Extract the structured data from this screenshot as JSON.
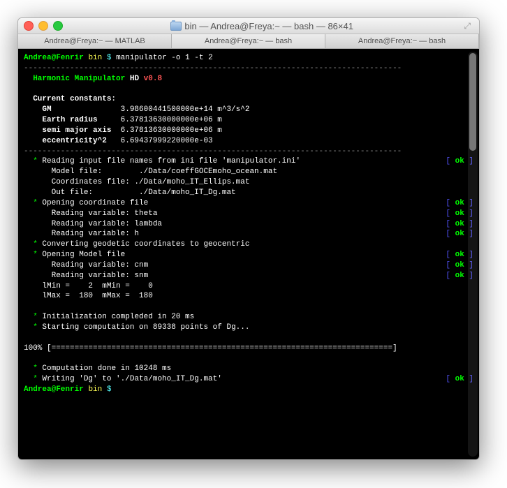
{
  "window": {
    "title": "bin — Andrea@Freya:~ — bash — 86×41"
  },
  "tabs": [
    {
      "label": "Andrea@Freya:~ — MATLAB"
    },
    {
      "label": "Andrea@Freya:~ — bash"
    },
    {
      "label": "Andrea@Freya:~ — bash"
    }
  ],
  "prompt": {
    "userhost": "Andrea@Fenrir",
    "dir": "bin",
    "sym": "$",
    "cmd": "manipulator -o 1 -t 2"
  },
  "rule": "----------------------------------------------------------------------------------",
  "header": {
    "prefix": "  Harmonic Manipulator",
    "hd": "HD",
    "ver": "v0.8"
  },
  "constants": {
    "heading": "  Current constants:",
    "rows": [
      {
        "k": "    GM             ",
        "v": "  3.98600441500000e+14 m^3/s^2"
      },
      {
        "k": "    Earth radius   ",
        "v": "  6.37813630000000e+06 m"
      },
      {
        "k": "    semi major axis",
        "v": "  6.37813630000000e+06 m"
      },
      {
        "k": "    eccentricity^2 ",
        "v": "  6.69437999220000e-03"
      }
    ]
  },
  "steps": [
    {
      "star": true,
      "text": "Reading input file names from ini file 'manipulator.ini'",
      "status": "ok"
    },
    {
      "star": false,
      "text": "  Model file:        ./Data/coeffGOCEmoho_ocean.mat"
    },
    {
      "star": false,
      "text": "  Coordinates file: ./Data/moho_IT_Ellips.mat"
    },
    {
      "star": false,
      "text": "  Out file:          ./Data/moho_IT_Dg.mat"
    },
    {
      "star": true,
      "text": "Opening coordinate file",
      "status": "ok"
    },
    {
      "star": false,
      "text": "  Reading variable: theta",
      "status": "ok"
    },
    {
      "star": false,
      "text": "  Reading variable: lambda",
      "status": "ok"
    },
    {
      "star": false,
      "text": "  Reading variable: h",
      "status": "ok"
    },
    {
      "star": true,
      "text": "Converting geodetic coordinates to geocentric"
    },
    {
      "star": true,
      "text": "Opening Model file",
      "status": "ok"
    },
    {
      "star": false,
      "text": "  Reading variable: cnm",
      "status": "ok"
    },
    {
      "star": false,
      "text": "  Reading variable: snm",
      "status": "ok"
    }
  ],
  "ranges": {
    "l1": "    lMin =    2  mMin =    0",
    "l2": "    lMax =  180  mMax =  180"
  },
  "init": {
    "line1": "Initialization compleded in 20 ms",
    "line2": "Starting computation on 89338 points of Dg..."
  },
  "progress": {
    "pct": "100%",
    "bar": " [==========================================================================]"
  },
  "done": {
    "line1": "Computation done in 10248 ms",
    "line2": "Writing 'Dg' to './Data/moho_IT_Dg.mat'",
    "status": "ok"
  },
  "ok": {
    "lb": "[ ",
    "txt": "ok",
    "rb": " ]"
  }
}
